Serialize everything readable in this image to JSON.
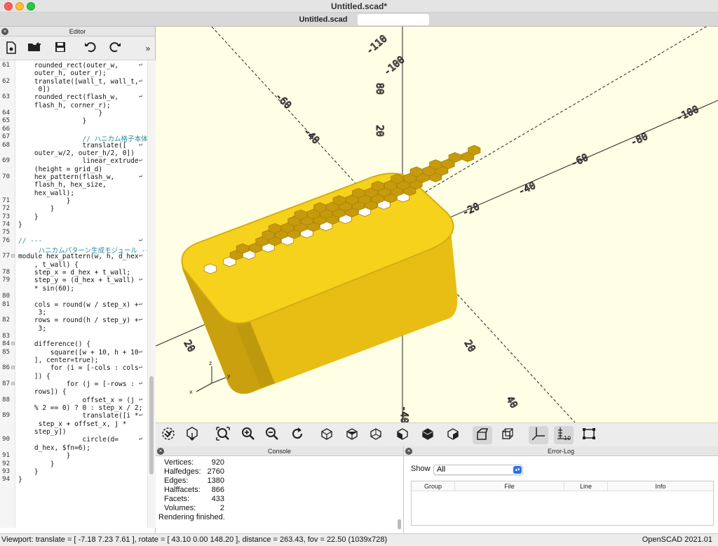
{
  "window": {
    "title": "Untitled.scad*",
    "tab": "Untitled.scad"
  },
  "editor": {
    "panel_title": "Editor",
    "toolbar": [
      "new-file-icon",
      "open-folder-icon",
      "save-icon",
      "undo-icon",
      "redo-icon",
      "more-icon"
    ],
    "lines": [
      {
        "n": "61",
        "t": "    rounded_rect(outer_w,",
        "w": true
      },
      {
        "n": "",
        "t": "    outer_h, outer_r);",
        "w": false
      },
      {
        "n": "62",
        "t": "    translate([wall_t, wall_t,",
        "w": true
      },
      {
        "n": "",
        "t": "     0])",
        "w": false
      },
      {
        "n": "63",
        "t": "    rounded_rect(flash_w,",
        "w": true
      },
      {
        "n": "",
        "t": "    flash_h, corner_r);",
        "w": false
      },
      {
        "n": "64",
        "t": "                    }",
        "w": false
      },
      {
        "n": "65",
        "t": "                }",
        "w": false
      },
      {
        "n": "66",
        "t": "",
        "w": false
      },
      {
        "n": "67",
        "t": "                // ハニカム格子本体",
        "w": false
      },
      {
        "n": "68",
        "t": "                translate([",
        "w": true
      },
      {
        "n": "",
        "t": "    outer_w/2, outer_h/2, 0])",
        "w": false
      },
      {
        "n": "69",
        "t": "                linear_extrude",
        "w": true
      },
      {
        "n": "",
        "t": "    (height = grid_d)",
        "w": false
      },
      {
        "n": "70",
        "t": "    hex_pattern(flash_w,",
        "w": true
      },
      {
        "n": "",
        "t": "    flash_h, hex_size,",
        "w": false
      },
      {
        "n": "",
        "t": "    hex_wall);",
        "w": false
      },
      {
        "n": "71",
        "t": "            }",
        "w": false
      },
      {
        "n": "72",
        "t": "        }",
        "w": false
      },
      {
        "n": "73",
        "t": "    }",
        "w": false
      },
      {
        "n": "74",
        "t": "}",
        "w": false
      },
      {
        "n": "75",
        "t": "",
        "w": false
      },
      {
        "n": "76",
        "t": "// ---",
        "w": true
      },
      {
        "n": "",
        "t": "     ハニカムパターン生成モジュール ---",
        "w": false
      },
      {
        "n": "77",
        "t": "module hex_pattern(w, h, d_hex",
        "w": true
      },
      {
        "n": "",
        "t": "    , t_wall) {",
        "w": false
      },
      {
        "n": "78",
        "t": "    step_x = d_hex + t_wall;",
        "w": false
      },
      {
        "n": "79",
        "t": "    step_y = (d_hex + t_wall)",
        "w": true
      },
      {
        "n": "",
        "t": "    * sin(60);",
        "w": false
      },
      {
        "n": "80",
        "t": "",
        "w": false
      },
      {
        "n": "81",
        "t": "    cols = round(w / step_x) +",
        "w": true
      },
      {
        "n": "",
        "t": "     3;",
        "w": false
      },
      {
        "n": "82",
        "t": "    rows = round(h / step_y) +",
        "w": true
      },
      {
        "n": "",
        "t": "     3;",
        "w": false
      },
      {
        "n": "83",
        "t": "",
        "w": false
      },
      {
        "n": "84",
        "t": "    difference() {",
        "w": false
      },
      {
        "n": "85",
        "t": "        square([w + 10, h + 10",
        "w": true
      },
      {
        "n": "",
        "t": "    ], center=true);",
        "w": false
      },
      {
        "n": "86",
        "t": "        for (i = [-cols : cols",
        "w": true
      },
      {
        "n": "",
        "t": "    ]) {",
        "w": false
      },
      {
        "n": "87",
        "t": "            for (j = [-rows :",
        "w": true
      },
      {
        "n": "",
        "t": "    rows]) {",
        "w": false
      },
      {
        "n": "88",
        "t": "                offset_x = (j",
        "w": true
      },
      {
        "n": "",
        "t": "    % 2 == 0) ? 0 : step_x / 2;",
        "w": false
      },
      {
        "n": "89",
        "t": "                translate([i *",
        "w": true
      },
      {
        "n": "",
        "t": "     step_x + offset_x, j *",
        "w": false
      },
      {
        "n": "",
        "t": "    step_y])",
        "w": false
      },
      {
        "n": "90",
        "t": "                circle(d=",
        "w": true
      },
      {
        "n": "",
        "t": "    d_hex, $fn=6);",
        "w": false
      },
      {
        "n": "91",
        "t": "            }",
        "w": false
      },
      {
        "n": "92",
        "t": "        }",
        "w": false
      },
      {
        "n": "93",
        "t": "    }",
        "w": false
      },
      {
        "n": "94",
        "t": "}",
        "w": false
      }
    ]
  },
  "view_toolbar": [
    "render-preview-icon",
    "render-export-icon",
    "zoom-all-icon",
    "zoom-in-icon",
    "zoom-out-icon",
    "reset-view-icon",
    "view-right-icon",
    "view-top-icon",
    "view-bottom-icon",
    "view-left-icon",
    "view-front-icon",
    "view-back-icon",
    "perspective-icon",
    "orthogonal-icon",
    "show-axes-icon",
    "show-scale-icon",
    "show-edges-icon"
  ],
  "console": {
    "title": "Console",
    "stats": [
      {
        "k": "Vertices:",
        "v": "920"
      },
      {
        "k": "Halfedges:",
        "v": "2760"
      },
      {
        "k": "Edges:",
        "v": "1380"
      },
      {
        "k": "Halffacets:",
        "v": "866"
      },
      {
        "k": "Facets:",
        "v": "433"
      },
      {
        "k": "Volumes:",
        "v": "2"
      }
    ],
    "footer": "Rendering finished."
  },
  "error_log": {
    "title": "Error-Log",
    "show_label": "Show",
    "show_value": "All",
    "columns": [
      "Group",
      "File",
      "Line",
      "Info"
    ]
  },
  "status": {
    "viewport": "Viewport: translate = [ -7.18 7.23 7.61 ], rotate = [ 43.10 0.00 148.20 ], distance = 263.43, fov = 22.50 (1039x728)",
    "version": "OpenSCAD 2021.01"
  },
  "colors": {
    "model": "#f4cd1a",
    "model_side": "#e0b412",
    "viewport_bg": "#ffffe5"
  }
}
